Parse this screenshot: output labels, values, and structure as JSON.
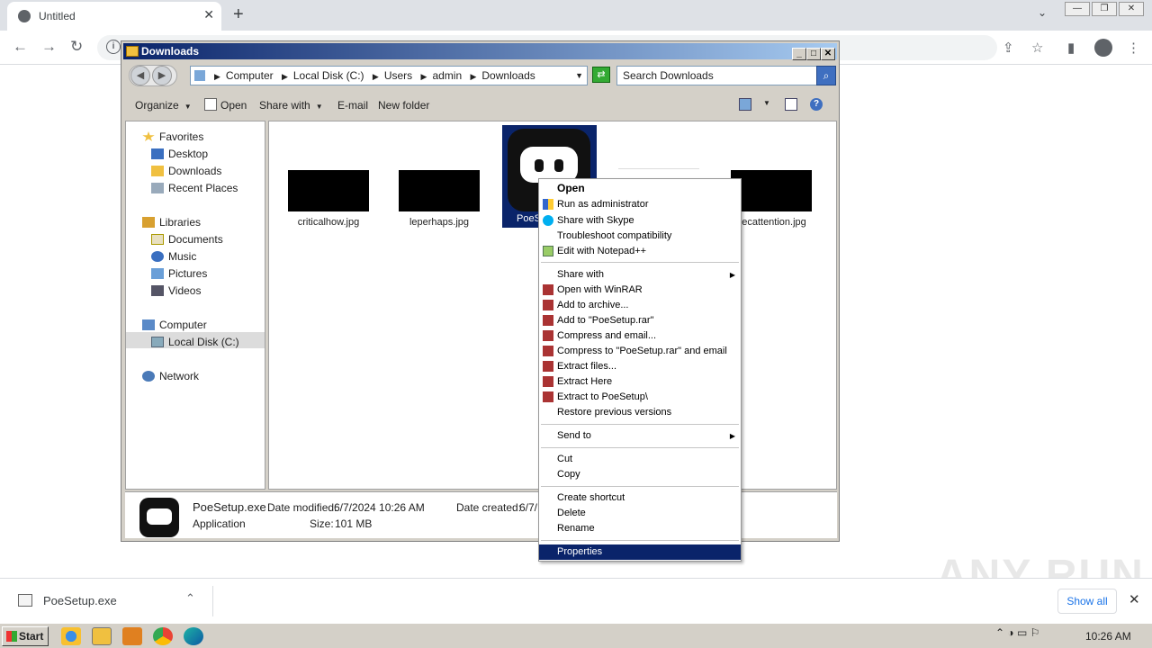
{
  "browser": {
    "tab_title": "Untitled",
    "tab_close": "✕",
    "new_tab": "+",
    "tab_search": "⌄",
    "win_minimize": "—",
    "win_restore": "❐",
    "win_close": "✕",
    "back": "←",
    "forward": "→",
    "reload": "↻",
    "site_info": "i",
    "share": "⇪",
    "bookmark": "☆",
    "sidepanel": "▮",
    "menu": "⋮"
  },
  "explorer": {
    "title": "Downloads",
    "title_min": "_",
    "title_max": "□",
    "title_close": "✕",
    "breadcrumb": [
      "Computer",
      "Local Disk (C:)",
      "Users",
      "admin",
      "Downloads"
    ],
    "search_placeholder": "Search Downloads",
    "toolbar": {
      "organize": "Organize",
      "open": "Open",
      "share_with": "Share with",
      "email": "E-mail",
      "new_folder": "New folder"
    },
    "nav": {
      "favorites": "Favorites",
      "desktop": "Desktop",
      "downloads": "Downloads",
      "recent_places": "Recent Places",
      "libraries": "Libraries",
      "documents": "Documents",
      "music": "Music",
      "pictures": "Pictures",
      "videos": "Videos",
      "computer": "Computer",
      "local_disk": "Local Disk (C:)",
      "network": "Network"
    },
    "files": {
      "file1": "criticalhow.jpg",
      "file2": "leperhaps.jpg",
      "file3_partial": "PoeS",
      "file5": "ecattention.jpg"
    },
    "details": {
      "name": "PoeSetup.exe",
      "type": "Application",
      "date_modified_label": "Date modified:",
      "date_modified": "6/7/2024 10:26 AM",
      "size_label": "Size:",
      "size": "101 MB",
      "date_created_label": "Date created:",
      "date_created_partial": "6/7/"
    }
  },
  "context_menu": {
    "open": "Open",
    "run_as_admin": "Run as administrator",
    "share_skype": "Share with Skype",
    "troubleshoot": "Troubleshoot compatibility",
    "edit_notepad": "Edit with Notepad++",
    "share_with": "Share with",
    "open_winrar": "Open with WinRAR",
    "add_archive": "Add to archive...",
    "add_rar": "Add to \"PoeSetup.rar\"",
    "compress_email": "Compress and email...",
    "compress_rar_email": "Compress to \"PoeSetup.rar\" and email",
    "extract_files": "Extract files...",
    "extract_here": "Extract Here",
    "extract_to": "Extract to PoeSetup\\",
    "restore": "Restore previous versions",
    "send_to": "Send to",
    "cut": "Cut",
    "copy": "Copy",
    "create_shortcut": "Create shortcut",
    "delete": "Delete",
    "rename": "Rename",
    "properties": "Properties",
    "submenu_arrow": "▶"
  },
  "shelf": {
    "download_name": "PoeSetup.exe",
    "chevron": "⌃",
    "show_all": "Show all",
    "close": "✕"
  },
  "watermark": "ANY RUN",
  "taskbar": {
    "start": "Start",
    "tray_icons": "⌃ ◑ ▭ ⚐",
    "clock": "10:26 AM"
  },
  "colors": {
    "selection": "#0a246a",
    "titlebar_start": "#0a246a",
    "titlebar_end": "#a6caf0",
    "link": "#1a73e8"
  }
}
